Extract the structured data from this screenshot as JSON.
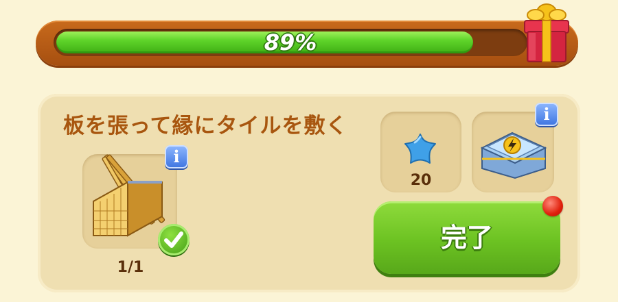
{
  "progress": {
    "percent_text": "89%",
    "fraction": 0.89
  },
  "task": {
    "title": "板を張って縁にタイルを敷く",
    "requirement_count": "1/1",
    "info_label": "i"
  },
  "reward": {
    "star_amount": "20",
    "info_label": "i"
  },
  "complete_button": {
    "label": "完了"
  },
  "colors": {
    "bar_green": "#5fd42a",
    "frame_orange": "#c86a1c",
    "button_green": "#6cc222",
    "title_brown": "#a8560f",
    "notify_red": "#e0200c",
    "info_blue": "#3c74e0"
  },
  "icons": [
    "gift-box-icon",
    "wood-planks-icon",
    "check-icon",
    "blue-star-icon",
    "energy-chest-icon",
    "info-icon",
    "notification-dot"
  ]
}
